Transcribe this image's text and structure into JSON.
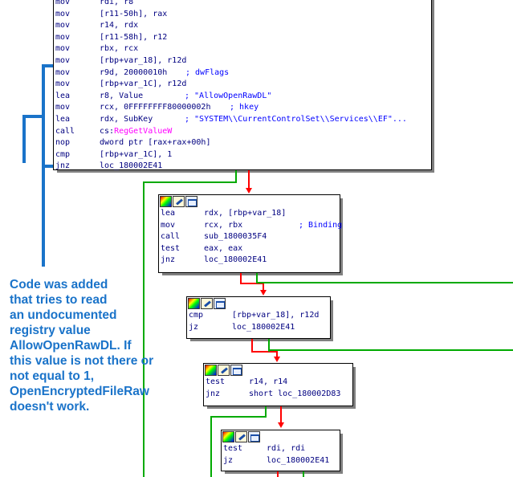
{
  "top_block": {
    "lines": [
      {
        "mnemonic": "mov",
        "operands": "rdi, r8",
        "comment": ""
      },
      {
        "mnemonic": "mov",
        "operands": "[r11-50h], rax",
        "comment": ""
      },
      {
        "mnemonic": "mov",
        "operands": "r14, rdx",
        "comment": ""
      },
      {
        "mnemonic": "mov",
        "operands": "[r11-58h], r12",
        "comment": ""
      },
      {
        "mnemonic": "mov",
        "operands": "rbx, rcx",
        "comment": ""
      },
      {
        "mnemonic": "mov",
        "operands": "[rbp+var_18], r12d",
        "comment": ""
      },
      {
        "mnemonic": "mov",
        "operands": "r9d, 20000010h",
        "comment": "; dwFlags"
      },
      {
        "mnemonic": "mov",
        "operands": "[rbp+var_1C], r12d",
        "comment": ""
      },
      {
        "mnemonic": "lea",
        "operands": "r8, Value",
        "comment": "; \"AllowOpenRawDL\""
      },
      {
        "mnemonic": "mov",
        "operands": "rcx, 0FFFFFFFF80000002h",
        "comment": "; hkey"
      },
      {
        "mnemonic": "lea",
        "operands": "rdx, SubKey",
        "comment": "; \"SYSTEM\\\\CurrentControlSet\\\\Services\\\\EF\"..."
      },
      {
        "mnemonic": "call",
        "operands": "cs:",
        "api": "RegGetValueW",
        "comment": ""
      },
      {
        "mnemonic": "nop",
        "operands": "dword ptr [rax+rax+00h]",
        "comment": ""
      },
      {
        "mnemonic": "cmp",
        "operands": "[rbp+var_1C], 1",
        "comment": ""
      },
      {
        "mnemonic": "jnz",
        "operands": "loc_180002E41",
        "comment": ""
      }
    ]
  },
  "block2": {
    "lines": [
      {
        "mnemonic": "lea",
        "operands": "rdx, [rbp+var_18]",
        "comment": ""
      },
      {
        "mnemonic": "mov",
        "operands": "rcx, rbx",
        "comment": "; Binding"
      },
      {
        "mnemonic": "call",
        "operands": "sub_1800035F4",
        "comment": ""
      },
      {
        "mnemonic": "test",
        "operands": "eax, eax",
        "comment": ""
      },
      {
        "mnemonic": "jnz",
        "operands": "loc_180002E41",
        "comment": ""
      }
    ]
  },
  "block3": {
    "lines": [
      {
        "mnemonic": "cmp",
        "operands": "[rbp+var_18], r12d",
        "comment": ""
      },
      {
        "mnemonic": "jz",
        "operands": "loc_180002E41",
        "comment": ""
      }
    ]
  },
  "block4": {
    "lines": [
      {
        "mnemonic": "test",
        "operands": "r14, r14",
        "comment": ""
      },
      {
        "mnemonic": "jnz",
        "operands": "short loc_180002D83",
        "comment": ""
      }
    ]
  },
  "block5": {
    "lines": [
      {
        "mnemonic": "test",
        "operands": "rdi, rdi",
        "comment": ""
      },
      {
        "mnemonic": "jz",
        "operands": "loc_180002E41",
        "comment": ""
      }
    ]
  },
  "annotation": {
    "lines": [
      "Code was added",
      "that tries to read",
      "an undocumented",
      "registry value",
      "AllowOpenRawDL. If",
      "this value is not there or",
      "not equal to 1,",
      "OpenEncryptedFileRaw",
      "doesn't work."
    ]
  },
  "colors": {
    "code": "#000080",
    "comment": "#0000ff",
    "api": "#ff00ff",
    "edge_taken": "#ff0000",
    "edge_fallthrough": "#00aa00",
    "annotation": "#1a73c9"
  },
  "icons": [
    "color-palette-icon",
    "rename-icon",
    "graph-view-icon"
  ]
}
